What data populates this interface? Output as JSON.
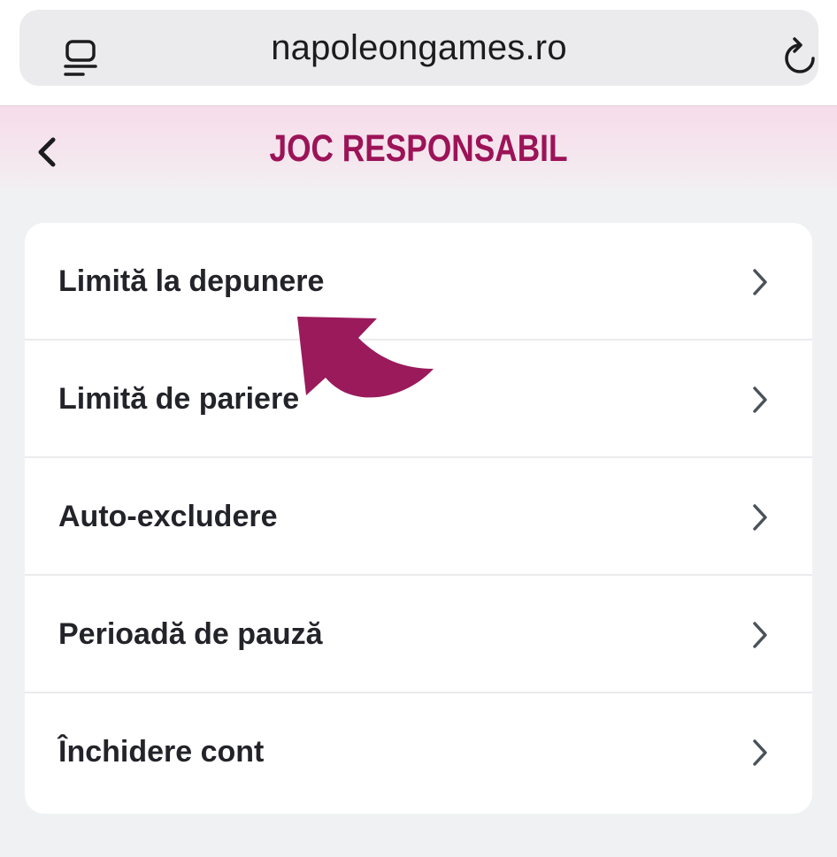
{
  "browser": {
    "url": "napoleongames.ro",
    "reader_icon": "reader-mode-icon",
    "reload_icon": "reload-icon"
  },
  "header": {
    "title": "JOC RESPONSABIL",
    "back_icon": "chevron-left-icon"
  },
  "menu": {
    "items": [
      {
        "label": "Limită la depunere"
      },
      {
        "label": "Limită de pariere"
      },
      {
        "label": "Auto-excludere"
      },
      {
        "label": "Perioadă de pauză"
      },
      {
        "label": "Închidere cont"
      }
    ]
  },
  "colors": {
    "accent": "#9c1358",
    "annotation_arrow": "#9a1a5c",
    "text": "#23232a",
    "background": "#f0f1f3"
  }
}
